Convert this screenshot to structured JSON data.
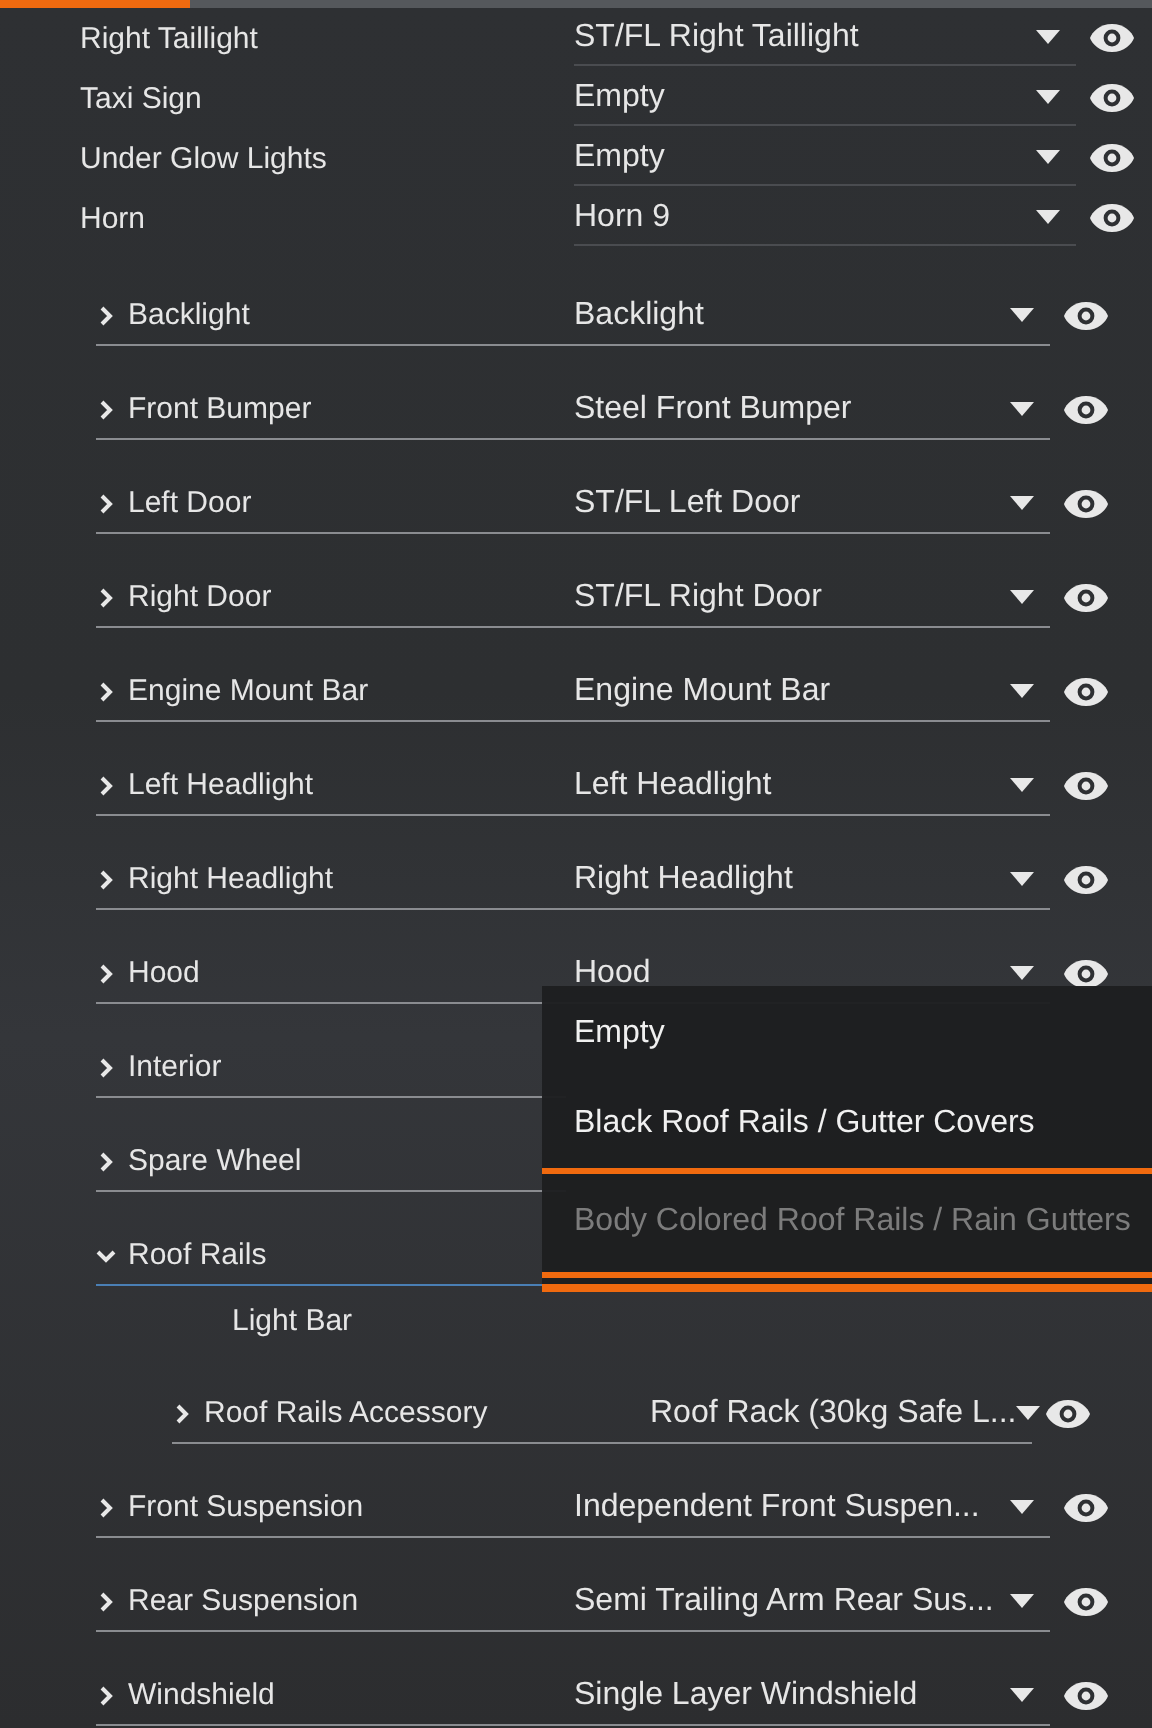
{
  "top_rows": [
    {
      "label": "Right Taillight",
      "value": "ST/FL Right Taillight"
    },
    {
      "label": "Taxi Sign",
      "value": "Empty"
    },
    {
      "label": "Under Glow Lights",
      "value": "Empty"
    },
    {
      "label": "Horn",
      "value": "Horn 9"
    }
  ],
  "parts": [
    {
      "kind": "group",
      "label": "Backlight",
      "value": "Backlight",
      "expanded": false
    },
    {
      "kind": "group",
      "label": "Front Bumper",
      "value": "Steel Front Bumper",
      "expanded": false
    },
    {
      "kind": "group",
      "label": "Left Door",
      "value": "ST/FL Left Door",
      "expanded": false
    },
    {
      "kind": "group",
      "label": "Right Door",
      "value": "ST/FL Right Door",
      "expanded": false
    },
    {
      "kind": "group",
      "label": "Engine Mount Bar",
      "value": "Engine Mount Bar",
      "expanded": false
    },
    {
      "kind": "group",
      "label": "Left Headlight",
      "value": "Left Headlight",
      "expanded": false
    },
    {
      "kind": "group",
      "label": "Right Headlight",
      "value": "Right Headlight",
      "expanded": false
    },
    {
      "kind": "group",
      "label": "Hood",
      "value": "Hood",
      "expanded": false
    },
    {
      "kind": "group",
      "label": "Interior",
      "expanded": false
    },
    {
      "kind": "group",
      "label": "Spare Wheel",
      "expanded": false
    },
    {
      "kind": "group",
      "label": "Roof Rails",
      "expanded": true,
      "children": [
        {
          "kind": "plain",
          "label": "Light Bar"
        },
        {
          "kind": "group",
          "label": "Roof Rails Accessory",
          "value": "Roof Rack (30kg Safe L...",
          "expanded": false
        }
      ]
    },
    {
      "kind": "group",
      "label": "Front Suspension",
      "value": "Independent Front Suspen...",
      "expanded": false
    },
    {
      "kind": "group",
      "label": "Rear Suspension",
      "value": "Semi Trailing Arm Rear Sus...",
      "expanded": false
    },
    {
      "kind": "group",
      "label": "Windshield",
      "value": "Single Layer Windshield",
      "expanded": false
    }
  ],
  "dropdown": {
    "options": [
      {
        "label": "Empty",
        "selected": false,
        "disabled": false
      },
      {
        "label": "Black Roof Rails / Gutter Covers",
        "selected": true,
        "disabled": false
      },
      {
        "label": "Body Colored Roof Rails / Rain Gutters",
        "selected": false,
        "disabled": true
      }
    ]
  }
}
